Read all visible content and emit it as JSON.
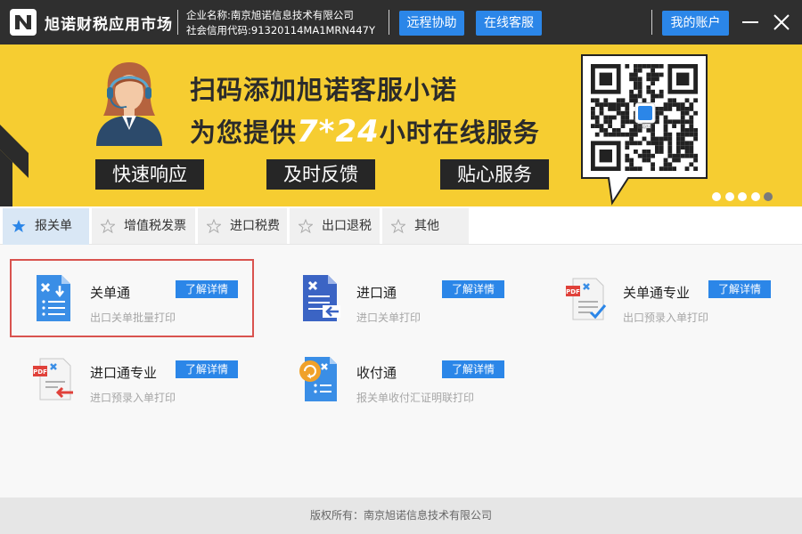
{
  "titlebar": {
    "app_title": "旭诺财税应用市场",
    "company_name_line": "企业名称:南京旭诺信息技术有限公司",
    "credit_code_line": "社会信用代码:91320114MA1MRN447Y",
    "remote_assist_label": "远程协助",
    "online_service_label": "在线客服",
    "my_account_label": "我的账户",
    "background": "#2f2f2f",
    "button_color": "#2b86e8"
  },
  "banner": {
    "line1": "扫码添加旭诺客服小诺",
    "line2_prefix": "为您提供",
    "line2_highlight": "7*24",
    "line2_suffix": "小时在线服务",
    "tags": [
      "快速响应",
      "及时反馈",
      "贴心服务"
    ],
    "qr_logo_text": "旭诺信息",
    "slide_count": 5,
    "active_slide": 5,
    "background": "#f6cd31"
  },
  "tabs": [
    {
      "label": "报关单",
      "active": true
    },
    {
      "label": "增值税发票",
      "active": false
    },
    {
      "label": "进口税费",
      "active": false
    },
    {
      "label": "出口退税",
      "active": false
    },
    {
      "label": "其他",
      "active": false
    }
  ],
  "apps": [
    {
      "name": "关单通",
      "desc": "出口关单批量打印",
      "detail_label": "了解详情",
      "icon": "customs-doc-download-icon",
      "selected": true
    },
    {
      "name": "进口通",
      "desc": "进口关单打印",
      "detail_label": "了解详情",
      "icon": "import-doc-arrow-icon",
      "selected": false
    },
    {
      "name": "关单通专业",
      "desc": "出口预录入单打印",
      "detail_label": "了解详情",
      "icon": "pdf-check-doc-icon",
      "selected": false
    },
    {
      "name": "进口通专业",
      "desc": "进口预录入单打印",
      "detail_label": "了解详情",
      "icon": "pdf-import-doc-icon",
      "selected": false
    },
    {
      "name": "收付通",
      "desc": "报关单收付汇证明联打印",
      "detail_label": "了解详情",
      "icon": "payment-doc-icon",
      "selected": false
    }
  ],
  "footer": {
    "copyright": "版权所有：南京旭诺信息技术有限公司"
  }
}
